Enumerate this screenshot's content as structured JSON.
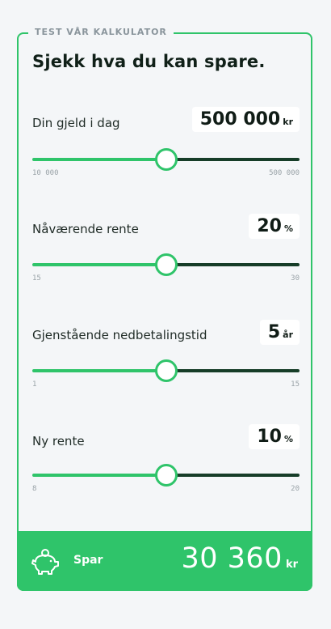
{
  "card": {
    "legend": "TEST VÅR KALKULATOR",
    "title": "Sjekk hva du kan spare."
  },
  "fields": [
    {
      "label": "Din gjeld i dag",
      "value": "500 000",
      "unit": "kr",
      "min": "10 000",
      "max": "500 000",
      "level": 0.5
    },
    {
      "label": "Nåværende rente",
      "value": "20",
      "unit": "%",
      "min": "15",
      "max": "30",
      "level": 0.5
    },
    {
      "label": "Gjenstående nedbetalingstid",
      "value": "5",
      "unit": "år",
      "min": "1",
      "max": "15",
      "level": 0.5
    },
    {
      "label": "Ny rente",
      "value": "10",
      "unit": "%",
      "min": "8",
      "max": "20",
      "level": 0.5
    }
  ],
  "footer": {
    "icon": "piggy-bank-icon",
    "label": "Spar",
    "value": "30 360",
    "unit": "kr"
  },
  "colors": {
    "accent": "#2fc46a",
    "track_dark": "#163d28",
    "background": "#f4f6f8"
  }
}
